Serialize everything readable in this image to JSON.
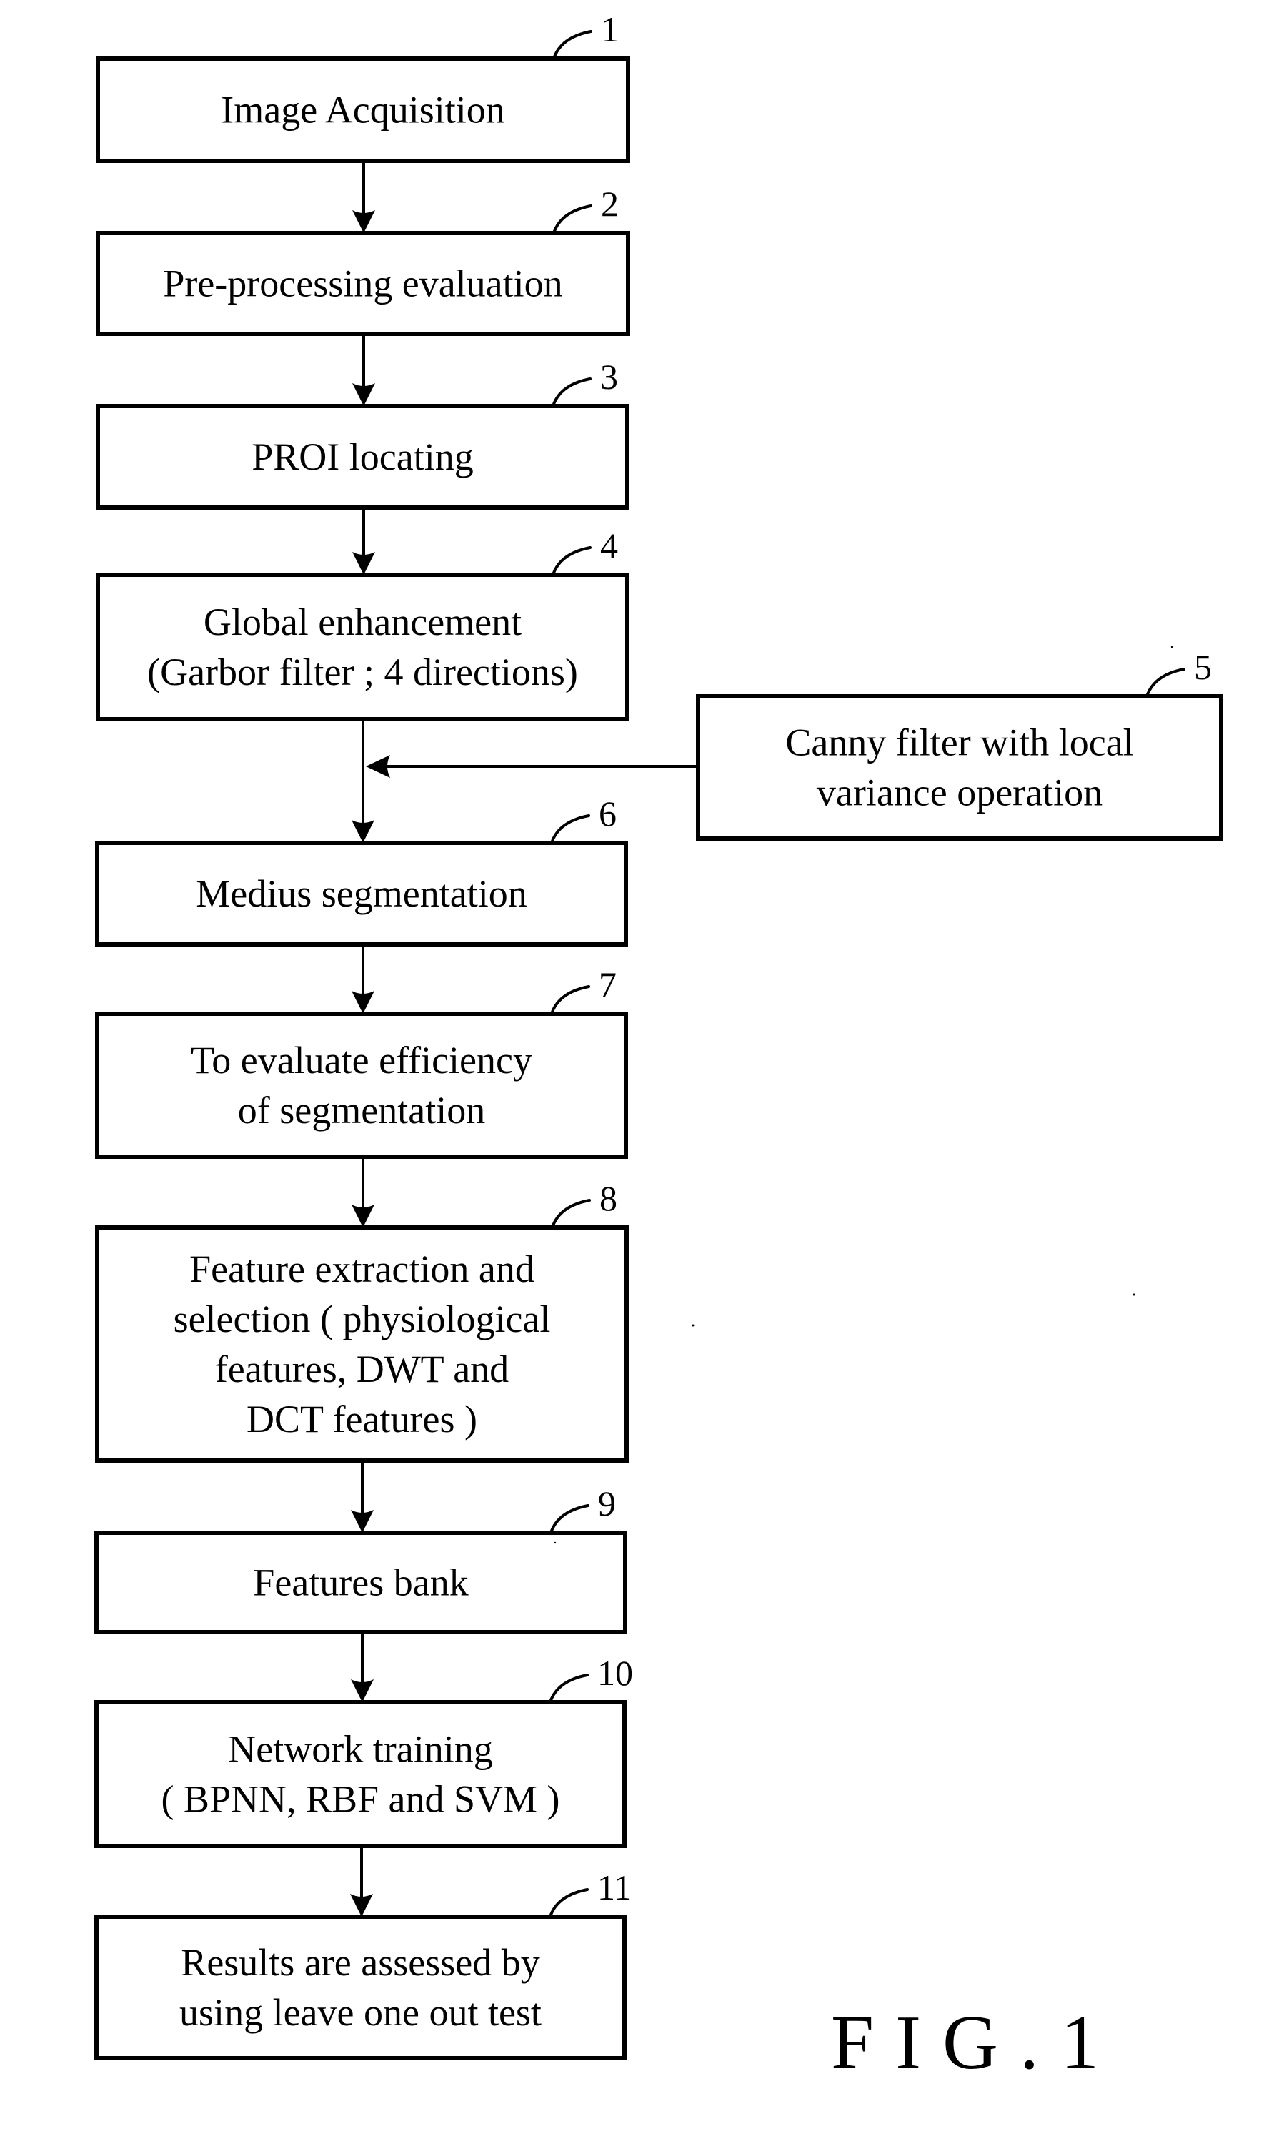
{
  "figure": {
    "caption": "FIG.1",
    "type": "flowchart"
  },
  "steps": [
    {
      "id": "1",
      "lines": [
        "Image Acquisition"
      ]
    },
    {
      "id": "2",
      "lines": [
        "Pre-processing evaluation"
      ]
    },
    {
      "id": "3",
      "lines": [
        "PROI locating"
      ]
    },
    {
      "id": "4",
      "lines": [
        "Global enhancement",
        "(Garbor filter ; 4 directions)"
      ]
    },
    {
      "id": "5",
      "lines": [
        "Canny filter with local",
        "variance operation"
      ]
    },
    {
      "id": "6",
      "lines": [
        "Medius segmentation"
      ]
    },
    {
      "id": "7",
      "lines": [
        "To evaluate efficiency",
        "of segmentation"
      ]
    },
    {
      "id": "8",
      "lines": [
        "Feature extraction and",
        "selection ( physiological",
        "features, DWT and",
        "DCT features )"
      ]
    },
    {
      "id": "9",
      "lines": [
        "Features bank"
      ]
    },
    {
      "id": "10",
      "lines": [
        "Network training",
        "( BPNN, RBF and SVM )"
      ]
    },
    {
      "id": "11",
      "lines": [
        "Results are assessed by",
        "using leave one out test"
      ]
    }
  ],
  "connections": [
    {
      "from": "1",
      "to": "2"
    },
    {
      "from": "2",
      "to": "3"
    },
    {
      "from": "3",
      "to": "4"
    },
    {
      "from": "4",
      "to": "6"
    },
    {
      "from": "5",
      "to": "4-6 line"
    },
    {
      "from": "6",
      "to": "7"
    },
    {
      "from": "7",
      "to": "8"
    },
    {
      "from": "8",
      "to": "9"
    },
    {
      "from": "9",
      "to": "10"
    },
    {
      "from": "10",
      "to": "11"
    }
  ]
}
